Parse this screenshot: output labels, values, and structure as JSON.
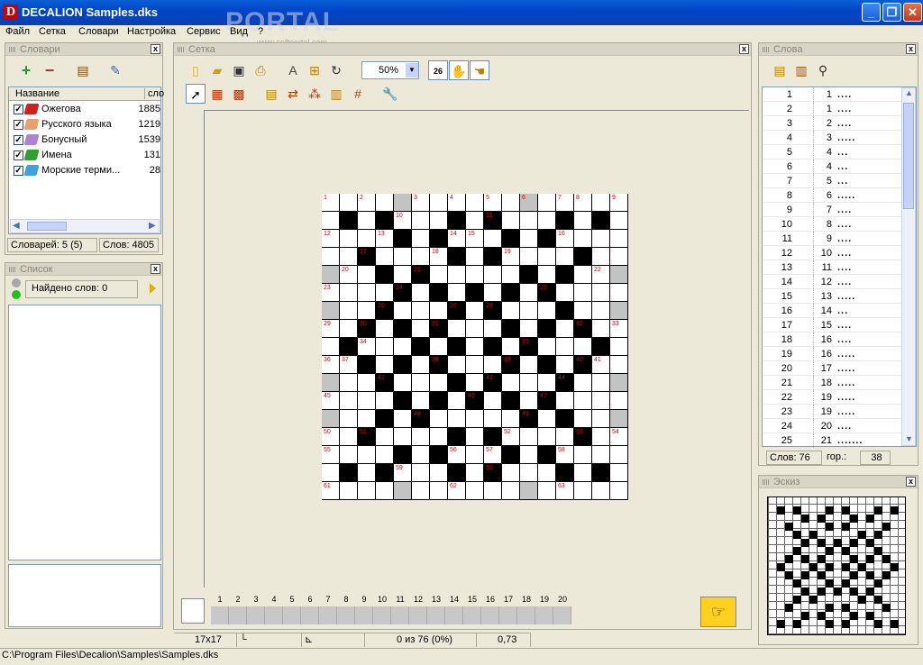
{
  "window": {
    "title": "DECALION Samples.dks",
    "icon": "D"
  },
  "watermark": {
    "text": "PORTAL",
    "sub": "www.softportal.com"
  },
  "menu": [
    "Файл",
    "Сетка",
    "Словари",
    "Настройка",
    "Сервис",
    "Вид",
    "?"
  ],
  "dictionaries": {
    "title": "Словари",
    "col_name": "Название",
    "col_words": "сло",
    "rows": [
      {
        "name": "Ожегова",
        "count": "1885",
        "color": "#d02020"
      },
      {
        "name": "Русского языка",
        "count": "1219",
        "color": "#e8a070"
      },
      {
        "name": "Бонусный",
        "count": "1539",
        "color": "#b080d8"
      },
      {
        "name": "Имена",
        "count": "131",
        "color": "#30a030"
      },
      {
        "name": "Морские терми...",
        "count": "28",
        "color": "#40a0e0"
      }
    ],
    "status_dicts": "Словарей: 5 (5)",
    "status_words": "Слов: 4805"
  },
  "list": {
    "title": "Список",
    "found": "Найдено слов: 0"
  },
  "grid": {
    "title": "Сетка",
    "zoom": "50%",
    "size": "17x17",
    "progress": "0 из 76 (0%)",
    "ratio": "0,73",
    "ruler": [
      "1",
      "2",
      "3",
      "4",
      "5",
      "6",
      "7",
      "8",
      "9",
      "10",
      "11",
      "12",
      "13",
      "14",
      "15",
      "16",
      "17",
      "18",
      "19",
      "20"
    ],
    "rows": [
      "bbbbgbbbbbbgbbbbb",
      "bkbkbbbkbkbbbkbkb",
      "bbbbkbkbbbkbkbbbb",
      "bbkbbbbkbkbbbbkbb",
      "gbbkbkbbbbbkbkbbg",
      "bbbbkbkbkbkbkbbbb",
      "gbbkbbbkbkbbbkbbg",
      "bbkbkbkbbbkbkbkbb",
      "bkbbbkbkbkbkbbbkb",
      "bbkbkbkbbbkbkbkbb",
      "gbbkbbbkbkbbbkbbg",
      "bbbbkbkbkbkbkbbbb",
      "gbbkbkbbbbbkbkbbg",
      "bbkbbbbkbkbbbbkbb",
      "bbbbkbkbbbkbkbbbb",
      "bkbkbbbkbkbbbkbkb",
      "bbbbgbbbbbbgbbbbb"
    ],
    "numbers": [
      [
        0,
        0,
        "1"
      ],
      [
        0,
        2,
        "2"
      ],
      [
        0,
        5,
        "3"
      ],
      [
        0,
        7,
        "4"
      ],
      [
        0,
        9,
        "5"
      ],
      [
        0,
        11,
        "6"
      ],
      [
        0,
        13,
        "7"
      ],
      [
        0,
        14,
        "8"
      ],
      [
        0,
        16,
        "9"
      ],
      [
        1,
        4,
        "10"
      ],
      [
        1,
        9,
        "11"
      ],
      [
        2,
        0,
        "12"
      ],
      [
        2,
        3,
        "13"
      ],
      [
        2,
        7,
        "14"
      ],
      [
        2,
        8,
        "15"
      ],
      [
        2,
        13,
        "16"
      ],
      [
        3,
        2,
        "17"
      ],
      [
        3,
        6,
        "18"
      ],
      [
        3,
        10,
        "19"
      ],
      [
        4,
        1,
        "20"
      ],
      [
        4,
        5,
        "21"
      ],
      [
        4,
        15,
        "22"
      ],
      [
        5,
        0,
        "23"
      ],
      [
        5,
        4,
        "24"
      ],
      [
        5,
        12,
        "25"
      ],
      [
        6,
        3,
        "26"
      ],
      [
        6,
        7,
        "27"
      ],
      [
        6,
        9,
        "28"
      ],
      [
        7,
        0,
        "29"
      ],
      [
        7,
        2,
        "30"
      ],
      [
        7,
        6,
        "31"
      ],
      [
        7,
        14,
        "32"
      ],
      [
        7,
        16,
        "33"
      ],
      [
        8,
        2,
        "34"
      ],
      [
        8,
        11,
        "35"
      ],
      [
        9,
        0,
        "36"
      ],
      [
        9,
        1,
        "37"
      ],
      [
        9,
        6,
        "38"
      ],
      [
        9,
        10,
        "39"
      ],
      [
        9,
        14,
        "40"
      ],
      [
        9,
        15,
        "41"
      ],
      [
        10,
        3,
        "42"
      ],
      [
        10,
        9,
        "43"
      ],
      [
        10,
        13,
        "44"
      ],
      [
        11,
        0,
        "45"
      ],
      [
        11,
        8,
        "46"
      ],
      [
        11,
        12,
        "47"
      ],
      [
        12,
        5,
        "48"
      ],
      [
        12,
        11,
        "49"
      ],
      [
        13,
        0,
        "50"
      ],
      [
        13,
        2,
        "51"
      ],
      [
        13,
        10,
        "52"
      ],
      [
        13,
        14,
        "53"
      ],
      [
        13,
        16,
        "54"
      ],
      [
        14,
        0,
        "55"
      ],
      [
        14,
        7,
        "56"
      ],
      [
        14,
        9,
        "57"
      ],
      [
        14,
        13,
        "58"
      ],
      [
        15,
        4,
        "59"
      ],
      [
        15,
        9,
        "60"
      ],
      [
        16,
        0,
        "61"
      ],
      [
        16,
        7,
        "62"
      ],
      [
        16,
        13,
        "63"
      ]
    ]
  },
  "words": {
    "title": "Слова",
    "status_count": "Слов: 76",
    "status_hor": "гор.:",
    "status_hor_val": "38",
    "rows": [
      [
        "1",
        "1",
        "...."
      ],
      [
        "2",
        "1",
        "...."
      ],
      [
        "3",
        "2",
        "...."
      ],
      [
        "4",
        "3",
        "....."
      ],
      [
        "5",
        "4",
        "..."
      ],
      [
        "6",
        "4",
        "..."
      ],
      [
        "7",
        "5",
        "..."
      ],
      [
        "8",
        "6",
        "....."
      ],
      [
        "9",
        "7",
        "...."
      ],
      [
        "10",
        "8",
        "...."
      ],
      [
        "11",
        "9",
        "...."
      ],
      [
        "12",
        "10",
        "...."
      ],
      [
        "13",
        "11",
        "...."
      ],
      [
        "14",
        "12",
        "...."
      ],
      [
        "15",
        "13",
        "....."
      ],
      [
        "16",
        "14",
        "..."
      ],
      [
        "17",
        "15",
        "...."
      ],
      [
        "18",
        "16",
        "...."
      ],
      [
        "19",
        "16",
        "....."
      ],
      [
        "20",
        "17",
        "....."
      ],
      [
        "21",
        "18",
        "....."
      ],
      [
        "22",
        "19",
        "....."
      ],
      [
        "23",
        "19",
        "....."
      ],
      [
        "24",
        "20",
        "...."
      ],
      [
        "25",
        "21",
        "......."
      ]
    ]
  },
  "sketch": {
    "title": "Эскиз"
  },
  "statusbar": {
    "path": "C:\\Program Files\\Decalion\\Samples\\Samples.dks"
  }
}
